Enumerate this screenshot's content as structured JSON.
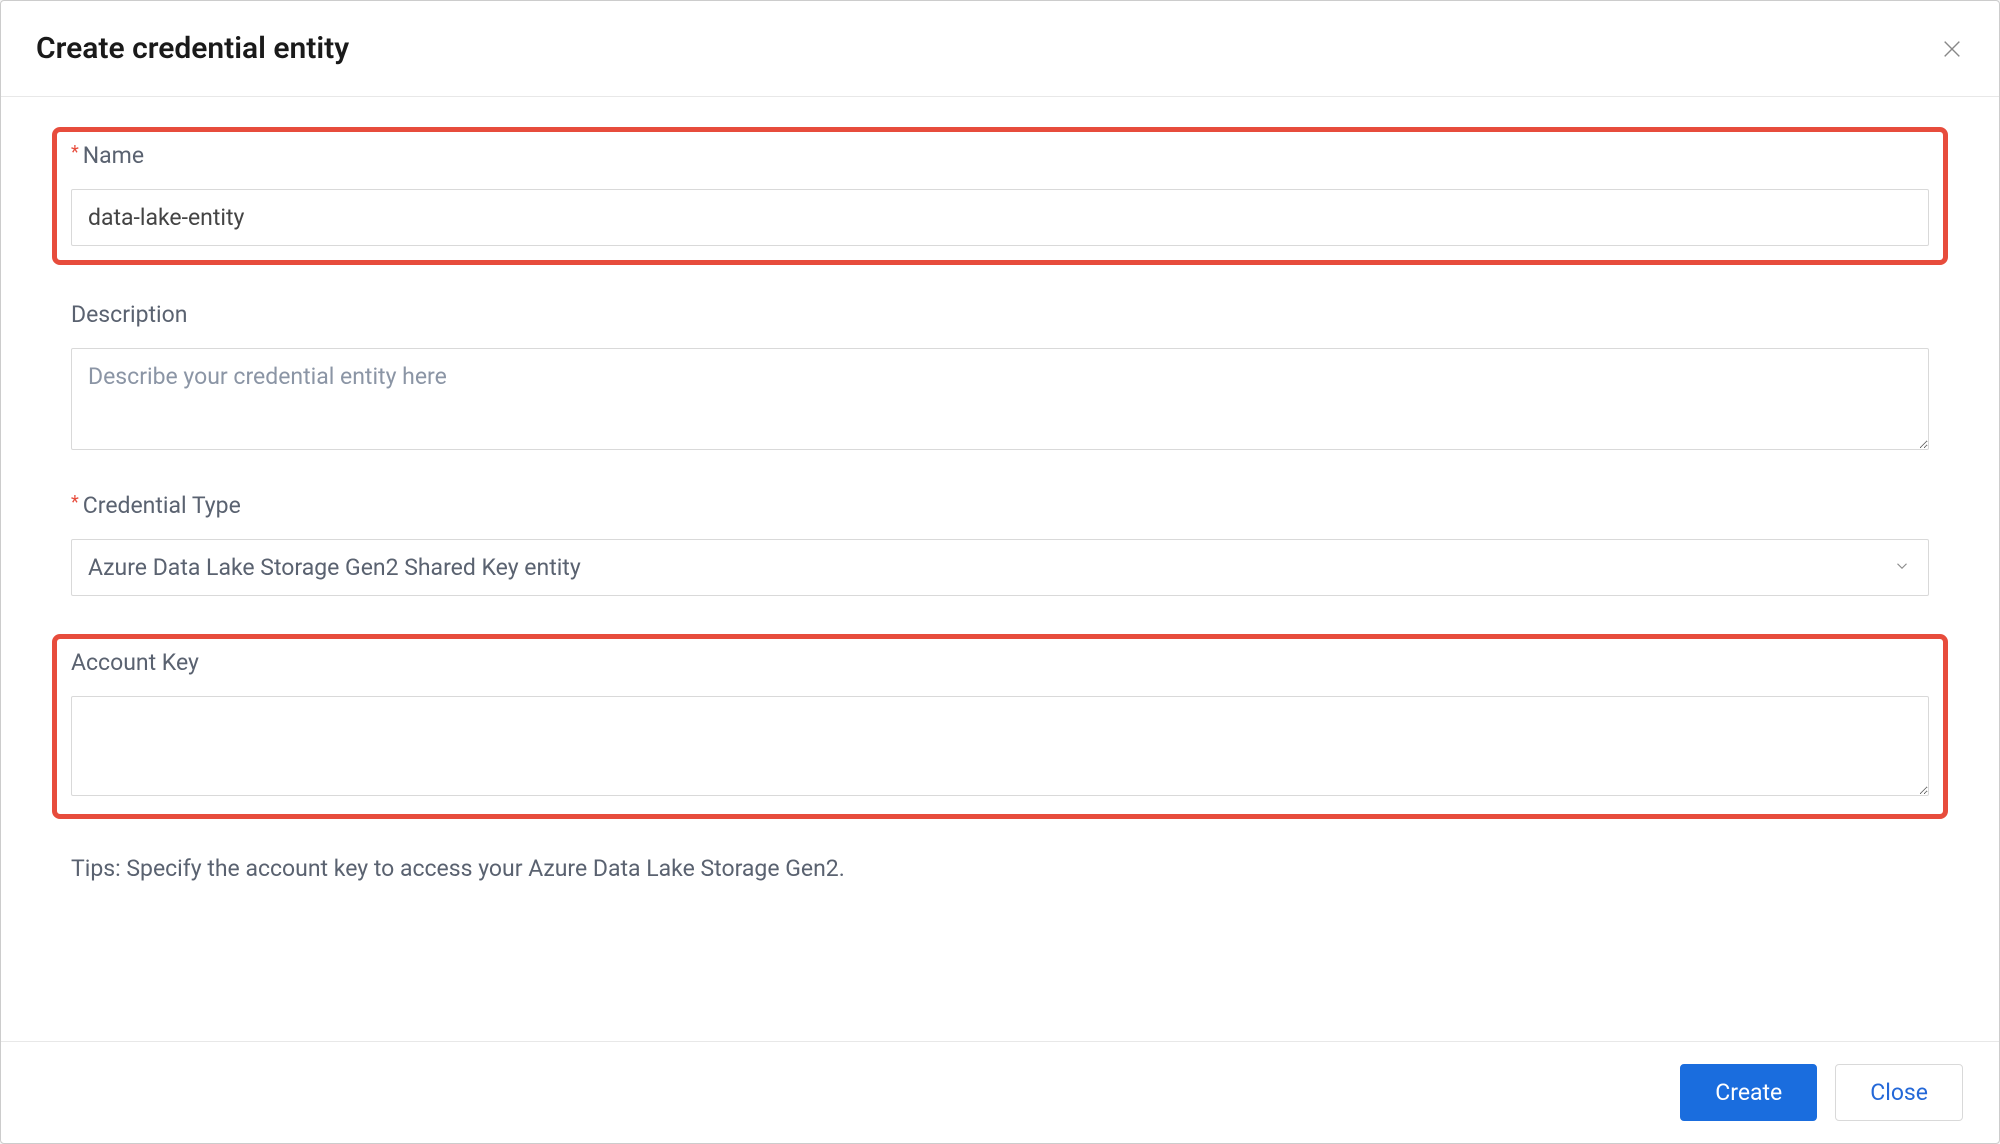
{
  "dialog": {
    "title": "Create credential entity"
  },
  "fields": {
    "name": {
      "label": "Name",
      "value": "data-lake-entity"
    },
    "description": {
      "label": "Description",
      "placeholder": "Describe your credential entity here"
    },
    "credentialType": {
      "label": "Credential Type",
      "value": "Azure Data Lake Storage Gen2 Shared Key entity"
    },
    "accountKey": {
      "label": "Account Key",
      "value": ""
    }
  },
  "tips": "Tips: Specify the account key to access your Azure Data Lake Storage Gen2.",
  "buttons": {
    "create": "Create",
    "close": "Close"
  }
}
